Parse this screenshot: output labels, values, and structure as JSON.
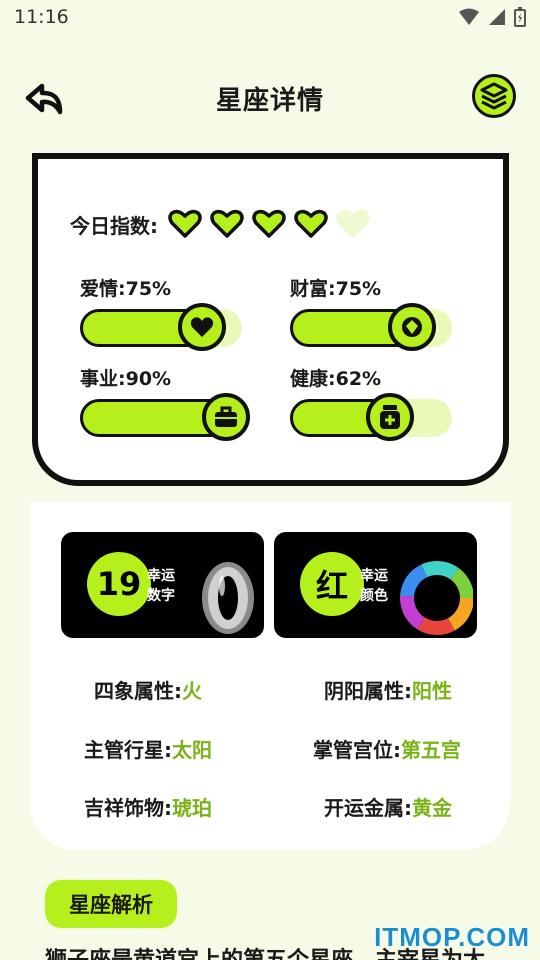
{
  "status": {
    "time": "11:16"
  },
  "header": {
    "title": "星座详情"
  },
  "today": {
    "label": "今日指数:",
    "rating": 4,
    "max": 5
  },
  "stats": [
    {
      "label": "爱情:",
      "percent": "75%",
      "level": 0.75,
      "icon": "heart-icon"
    },
    {
      "label": "财富:",
      "percent": "75%",
      "level": 0.75,
      "icon": "diamond-icon"
    },
    {
      "label": "事业:",
      "percent": "90%",
      "level": 0.9,
      "icon": "briefcase-icon"
    },
    {
      "label": "健康:",
      "percent": "62%",
      "level": 0.62,
      "icon": "medicine-icon"
    }
  ],
  "lucky": [
    {
      "value": "19",
      "line1": "幸运",
      "line2": "数字"
    },
    {
      "value": "红",
      "line1": "幸运",
      "line2": "颜色"
    }
  ],
  "attributes": [
    {
      "key": "四象属性:",
      "value": "火"
    },
    {
      "key": "阴阳属性:",
      "value": "阳性"
    },
    {
      "key": "主管行星:",
      "value": "太阳"
    },
    {
      "key": "掌管宫位:",
      "value": "第五宫"
    },
    {
      "key": "吉祥饰物:",
      "value": "琥珀"
    },
    {
      "key": "开运金属:",
      "value": "黄金"
    }
  ],
  "analysis": {
    "tag": "星座解析",
    "text": "狮子座是黄道宫上的第五个星座，主宰星为太"
  },
  "watermark": "ITMOP.COM",
  "colors": {
    "accent": "#b5ef1c",
    "value_text": "#7ab317",
    "background": "#f5fbe6"
  }
}
